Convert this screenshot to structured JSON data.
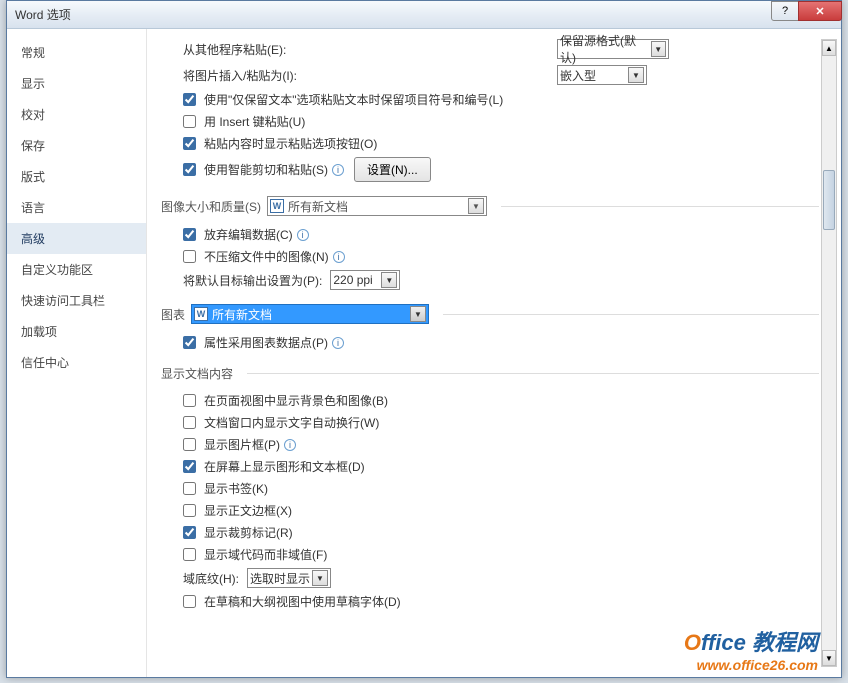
{
  "title": "Word 选项",
  "titlebar": {
    "help_icon": "?",
    "close_icon": "✕"
  },
  "sidebar": {
    "items": [
      "常规",
      "显示",
      "校对",
      "保存",
      "版式",
      "语言",
      "高级",
      "自定义功能区",
      "快速访问工具栏",
      "加载项",
      "信任中心"
    ],
    "selected_index": 6
  },
  "paste": {
    "from_other_label": "从其他程序粘贴(E):",
    "from_other_value": "保留源格式(默认)",
    "insert_pic_label": "将图片插入/粘贴为(I):",
    "insert_pic_value": "嵌入型",
    "keep_text_only": "使用\"仅保留文本\"选项粘贴文本时保留项目符号和编号(L)",
    "use_insert_key": "用 Insert 键粘贴(U)",
    "show_paste_options": "粘贴内容时显示粘贴选项按钮(O)",
    "smart_cut_paste": "使用智能剪切和粘贴(S)",
    "settings_btn": "设置(N)..."
  },
  "image_quality": {
    "header": "图像大小和质量(S)",
    "target_doc": "所有新文档",
    "discard_edit": "放弃编辑数据(C)",
    "no_compress": "不压缩文件中的图像(N)",
    "default_target_label": "将默认目标输出设置为(P):",
    "default_target_value": "220 ppi"
  },
  "chart": {
    "header": "图表",
    "target_doc": "所有新文档",
    "use_datapoints": "属性采用图表数据点(P)"
  },
  "display_content": {
    "header": "显示文档内容",
    "show_bg": "在页面视图中显示背景色和图像(B)",
    "wrap_text": "文档窗口内显示文字自动换行(W)",
    "show_pic_frame": "显示图片框(P)",
    "show_drawings": "在屏幕上显示图形和文本框(D)",
    "show_bookmarks": "显示书签(K)",
    "show_text_bound": "显示正文边框(X)",
    "show_crop": "显示裁剪标记(R)",
    "show_field_codes": "显示域代码而非域值(F)",
    "field_shading_label": "域底纹(H):",
    "field_shading_value": "选取时显示",
    "draft_font": "在草稿和大纲视图中使用草稿字体(D)"
  },
  "watermark": {
    "line1a": "O",
    "line1b": "ffice 教程网",
    "line2": "www.office26.com"
  }
}
